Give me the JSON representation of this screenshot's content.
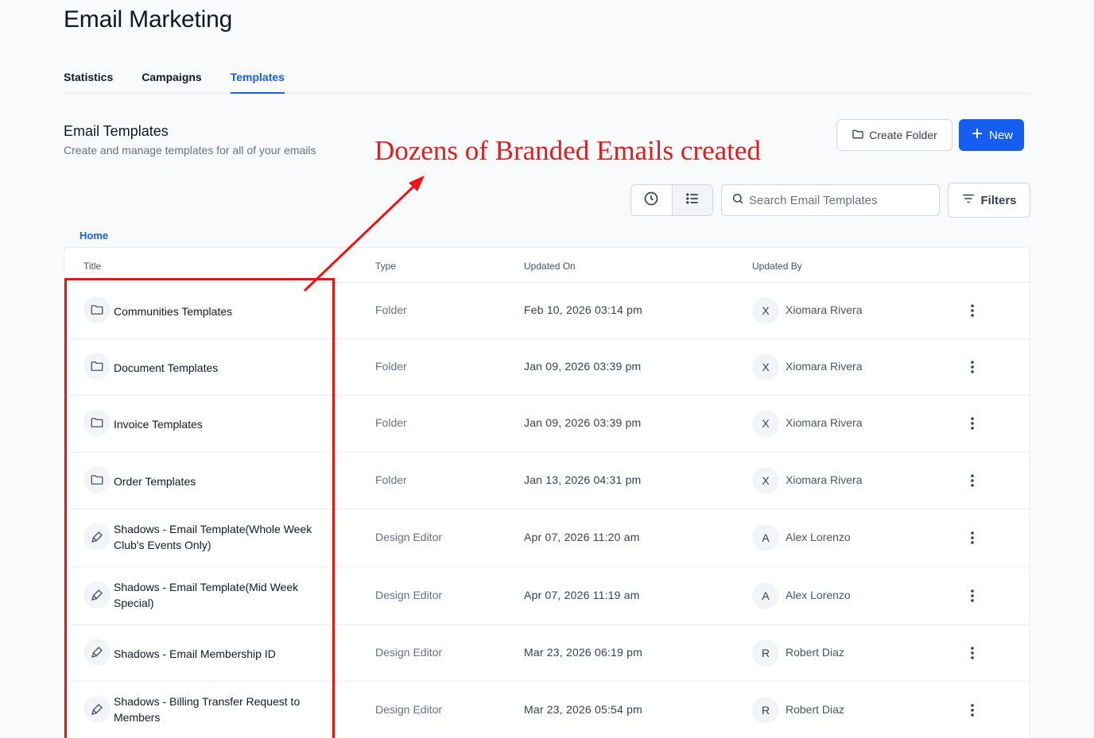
{
  "app": {
    "title": "Email Marketing"
  },
  "tabs": [
    {
      "label": "Statistics",
      "active": false
    },
    {
      "label": "Campaigns",
      "active": false
    },
    {
      "label": "Templates",
      "active": true
    }
  ],
  "section": {
    "title": "Email Templates",
    "subtitle": "Create and manage templates for all of your emails"
  },
  "actions": {
    "create_folder_label": "Create Folder",
    "new_label": "New",
    "filters_label": "Filters"
  },
  "view_toggle": {
    "options": [
      "clock-icon",
      "list-icon"
    ],
    "active": "list-icon"
  },
  "search": {
    "placeholder": "Search Email Templates",
    "value": ""
  },
  "breadcrumb": {
    "home": "Home"
  },
  "table": {
    "headers": {
      "title": "Title",
      "type": "Type",
      "updated_on": "Updated On",
      "updated_by": "Updated By"
    },
    "rows": [
      {
        "icon": "folder-icon",
        "title": "Communities Templates",
        "type": "Folder",
        "updated_on": "Feb 10, 2026 03:14 pm",
        "initial": "X",
        "updated_by": "Xiomara Rivera"
      },
      {
        "icon": "folder-icon",
        "title": "Document Templates",
        "type": "Folder",
        "updated_on": "Jan 09, 2026 03:39 pm",
        "initial": "X",
        "updated_by": "Xiomara Rivera"
      },
      {
        "icon": "folder-icon",
        "title": "Invoice Templates",
        "type": "Folder",
        "updated_on": "Jan 09, 2026 03:39 pm",
        "initial": "X",
        "updated_by": "Xiomara Rivera"
      },
      {
        "icon": "folder-icon",
        "title": "Order Templates",
        "type": "Folder",
        "updated_on": "Jan 13, 2026 04:31 pm",
        "initial": "X",
        "updated_by": "Xiomara Rivera"
      },
      {
        "icon": "brush-icon",
        "title": "Shadows - Email Template(Whole Week Club's Events Only)",
        "type": "Design Editor",
        "updated_on": "Apr 07, 2026 11:20 am",
        "initial": "A",
        "updated_by": "Alex Lorenzo"
      },
      {
        "icon": "brush-icon",
        "title": "Shadows - Email Template(Mid Week Special)",
        "type": "Design Editor",
        "updated_on": "Apr 07, 2026 11:19 am",
        "initial": "A",
        "updated_by": "Alex Lorenzo"
      },
      {
        "icon": "brush-icon",
        "title": "Shadows - Email Membership ID",
        "type": "Design Editor",
        "updated_on": "Mar 23, 2026 06:19 pm",
        "initial": "R",
        "updated_by": "Robert Diaz"
      },
      {
        "icon": "brush-icon",
        "title": "Shadows - Billing Transfer Request to Members",
        "type": "Design Editor",
        "updated_on": "Mar 23, 2026 05:54 pm",
        "initial": "R",
        "updated_by": "Robert Diaz"
      }
    ]
  },
  "annotation": {
    "text": "Dozens of Branded Emails created",
    "color": "#e31b1b"
  },
  "colors": {
    "accent": "#155eef",
    "annotation": "#ef1212"
  }
}
